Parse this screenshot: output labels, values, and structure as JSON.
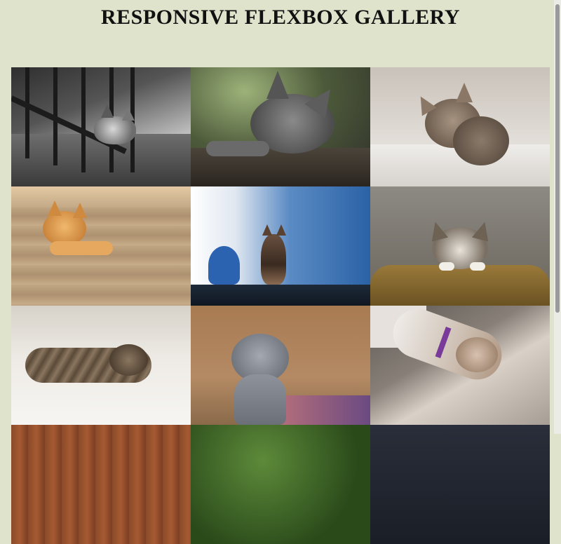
{
  "page": {
    "title": "RESPONSIVE FLEXBOX GALLERY",
    "background": "#dfe3cc"
  },
  "gallery": {
    "items": [
      {
        "subject": "tabby kitten peeking through balcony railing",
        "palette": [
          "#3a3a3a",
          "#9c9c9c"
        ]
      },
      {
        "subject": "grey kitten lying on wooden deck",
        "palette": [
          "#4a5a3a",
          "#6b6b6b"
        ]
      },
      {
        "subject": "fluffy kitten on white blanket",
        "palette": [
          "#cfcac4",
          "#8a7866"
        ]
      },
      {
        "subject": "ginger kitten on carpeted stairs",
        "palette": [
          "#b49a78",
          "#d8a060"
        ]
      },
      {
        "subject": "tabby kitten sitting on blue background",
        "palette": [
          "#2e67a8",
          "#6a4e3a"
        ]
      },
      {
        "subject": "tabby and white kitten peeking over cushion",
        "palette": [
          "#7a7468",
          "#8a6a2a"
        ]
      },
      {
        "subject": "tabby kitten stretched out on white rug",
        "palette": [
          "#e6e2dc",
          "#6a5a48"
        ]
      },
      {
        "subject": "grey scottish fold kitten",
        "palette": [
          "#a8774e",
          "#8b9099"
        ]
      },
      {
        "subject": "sleeping kitten in sunlight",
        "palette": [
          "#6f6862",
          "#d8cfc6"
        ]
      },
      {
        "subject": "kitten on wooden floor",
        "palette": [
          "#8a4a2a",
          "#6a3a22"
        ]
      },
      {
        "subject": "kitten in green grass",
        "palette": [
          "#3d6a2a",
          "#2a4a1a"
        ]
      },
      {
        "subject": "kitten on dark background",
        "palette": [
          "#2a2e3a",
          "#1a1e26"
        ]
      }
    ]
  }
}
